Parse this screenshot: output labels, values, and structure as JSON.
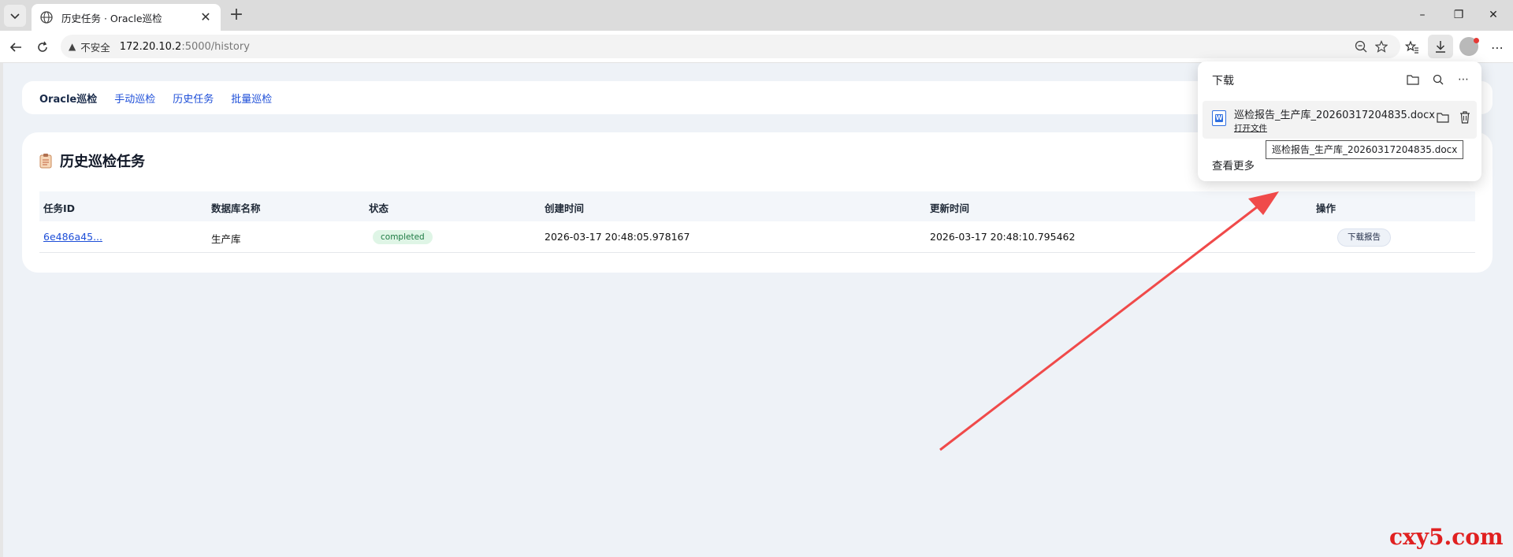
{
  "browser": {
    "tab_title": "历史任务 · Oracle巡检",
    "security_label": "不安全",
    "url_host": "172.20.10.2",
    "url_path": ":5000/history"
  },
  "nav": {
    "brand": "Oracle巡检",
    "links": [
      "手动巡检",
      "历史任务",
      "批量巡检"
    ]
  },
  "page": {
    "title": "历史巡检任务",
    "columns": [
      "任务ID",
      "数据库名称",
      "状态",
      "创建时间",
      "更新时间",
      "操作"
    ],
    "rows": [
      {
        "task_id": "6e486a45...",
        "db_name": "生产库",
        "status": "completed",
        "created": "2026-03-17 20:48:05.978167",
        "updated": "2026-03-17 20:48:10.795462",
        "action": "下载报告"
      }
    ]
  },
  "downloads": {
    "title": "下载",
    "file_name": "巡检报告_生产库_20260317204835.docx",
    "open_label": "打开文件",
    "more_label": "查看更多",
    "tooltip": "巡检报告_生产库_20260317204835.docx"
  },
  "watermark": "cxy5.com",
  "colors": {
    "accent": "#1d4ed8",
    "status_bg": "#dff5e6",
    "status_text": "#1e7a43",
    "arrow": "#f04a4a"
  }
}
